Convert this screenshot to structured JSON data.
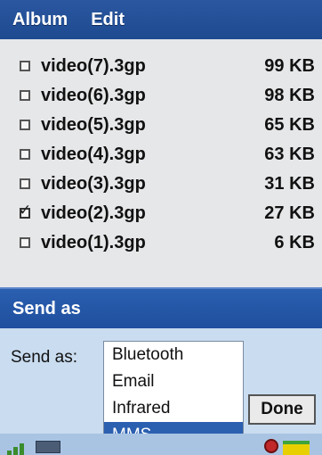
{
  "menubar": {
    "album": "Album",
    "edit": "Edit"
  },
  "files": [
    {
      "name": "video(7).3gp",
      "size": "99 KB",
      "checked": false
    },
    {
      "name": "video(6).3gp",
      "size": "98 KB",
      "checked": false
    },
    {
      "name": "video(5).3gp",
      "size": "65 KB",
      "checked": false
    },
    {
      "name": "video(4).3gp",
      "size": "63 KB",
      "checked": false
    },
    {
      "name": "video(3).3gp",
      "size": "31 KB",
      "checked": false
    },
    {
      "name": "video(2).3gp",
      "size": "27 KB",
      "checked": true
    },
    {
      "name": "video(1).3gp",
      "size": "6 KB",
      "checked": false
    }
  ],
  "dialog": {
    "title": "Send as",
    "label": "Send as:",
    "options": [
      "Bluetooth",
      "Email",
      "Infrared",
      "MMS"
    ],
    "selected": "MMS",
    "done": "Done"
  },
  "colors": {
    "titlebar": "#1e4a90",
    "selection": "#2b5fb0",
    "dialog_bg": "#c9dcf0"
  }
}
